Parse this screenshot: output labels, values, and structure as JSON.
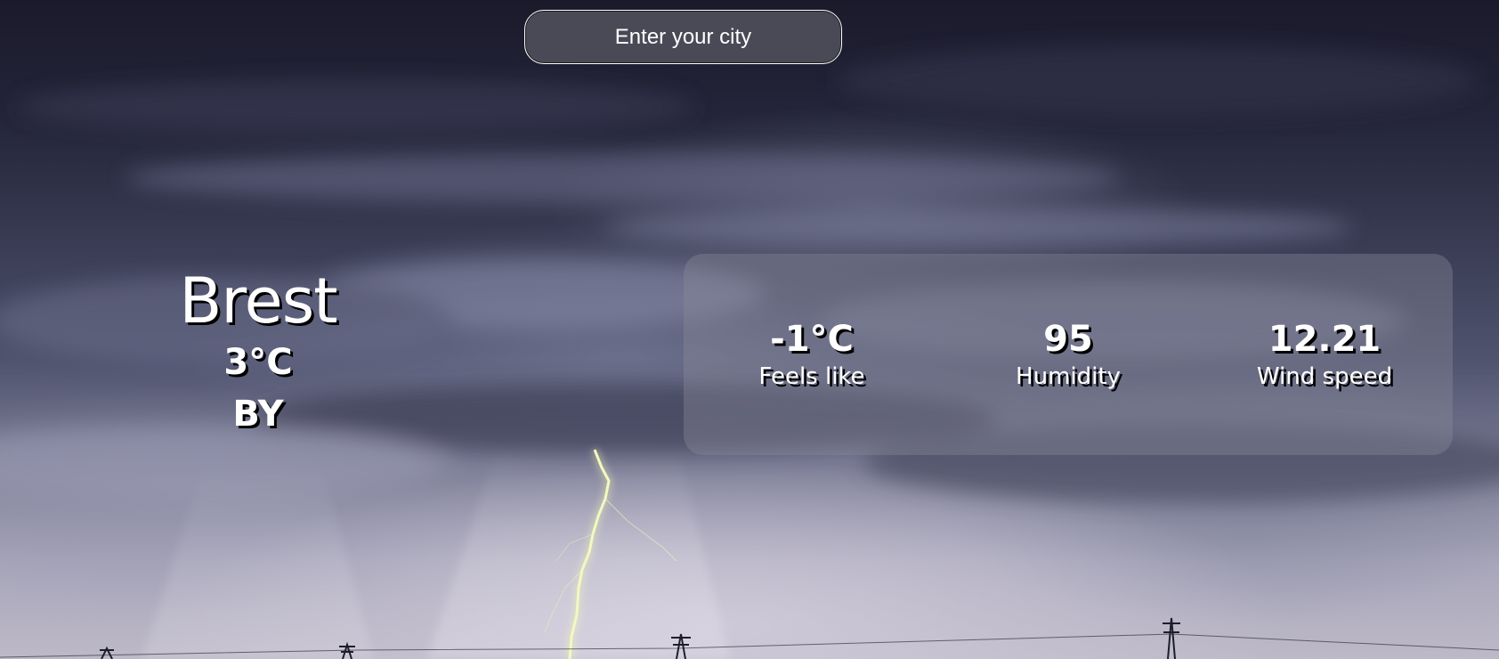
{
  "search": {
    "placeholder": "Enter your city"
  },
  "current": {
    "city": "Brest",
    "temperature": "3°C",
    "country": "BY"
  },
  "details": {
    "feels_like": {
      "value": "-1°C",
      "label": "Feels like"
    },
    "humidity": {
      "value": "95",
      "label": "Humidity"
    },
    "wind_speed": {
      "value": "12.21",
      "label": "Wind speed"
    }
  },
  "colors": {
    "text": "#ffffff",
    "text_shadow": "#000000",
    "sky_top": "#1b1a2b",
    "sky_bottom": "#bdb9c8",
    "lightning": "#f4f8c0"
  },
  "background": {
    "scene": "stormy-sky-lightning-background"
  }
}
